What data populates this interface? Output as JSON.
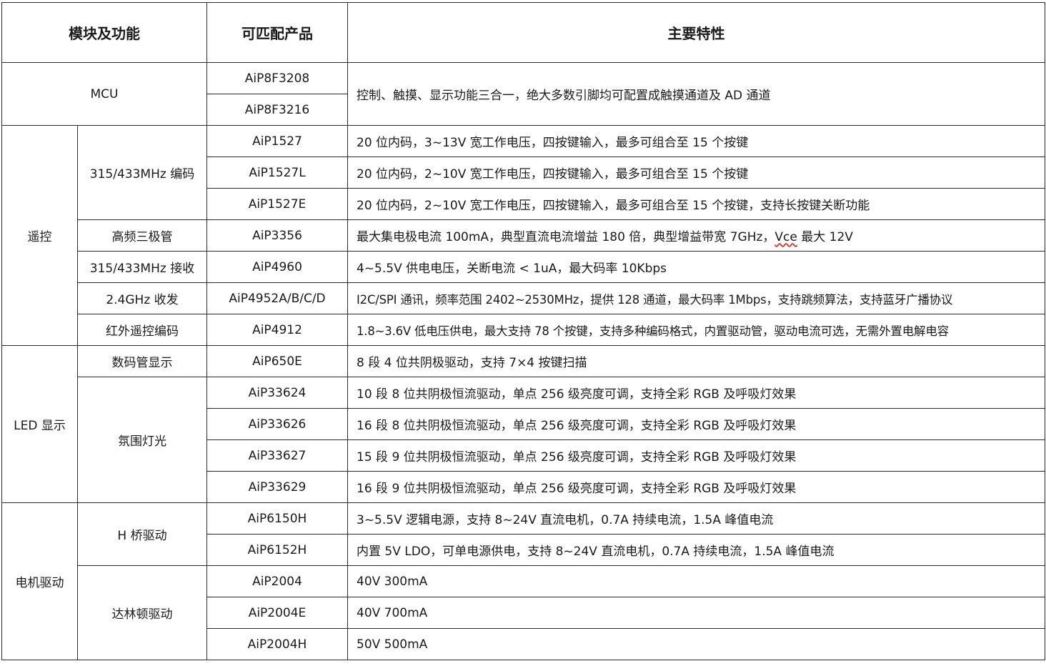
{
  "header": {
    "module": "模块及功能",
    "product": "可匹配产品",
    "feature": "主要特性"
  },
  "mcu": {
    "label": "MCU",
    "products": [
      "AiP8F3208",
      "AiP8F3216"
    ],
    "feature": "控制、触摸、显示功能三合一，绝大多数引脚均可配置成触摸通道及 AD 通道"
  },
  "remote": {
    "label": "遥控",
    "sub_encode": "315/433MHz 编码",
    "sub_triode": "高频三极管",
    "sub_receive": "315/433MHz 接收",
    "sub_24g": "2.4GHz 收发",
    "sub_ir": "红外遥控编码",
    "rows": [
      {
        "product": "AiP1527",
        "feature": "20 位内码，3~13V 宽工作电压，四按键输入，最多可组合至 15 个按键"
      },
      {
        "product": "AiP1527L",
        "feature": "20 位内码，2~10V 宽工作电压，四按键输入，最多可组合至 15 个按键"
      },
      {
        "product": "AiP1527E",
        "feature": "20 位内码，2~10V 宽工作电压，四按键输入，最多可组合至 15 个按键，支持长按键关断功能"
      },
      {
        "product": "AiP3356",
        "feature_pre": "最大集电极电流 100mA，典型直流电流增益 180 倍，典型增益带宽 7GHz，",
        "feature_vce": "Vce",
        "feature_post": " 最大 12V"
      },
      {
        "product": "AiP4960",
        "feature": "4~5.5V 供电电压，关断电流 < 1uA，最大码率 10Kbps"
      },
      {
        "product": "AiP4952A/B/C/D",
        "feature": "I2C/SPI 通讯，频率范围 2402~2530MHz，提供 128 通道，最大码率 1Mbps，支持跳频算法，支持蓝牙广播协议"
      },
      {
        "product": "AiP4912",
        "feature": "1.8~3.6V 低电压供电，最大支持 78 个按键，支持多种编码格式，内置驱动管，驱动电流可选，无需外置电解电容"
      }
    ]
  },
  "led": {
    "label": "LED 显示",
    "sub_digit": "数码管显示",
    "sub_ambient": "氛围灯光",
    "rows": [
      {
        "product": "AiP650E",
        "feature": "8 段 4 位共阴极驱动，支持 7×4 按键扫描"
      },
      {
        "product": "AiP33624",
        "feature": "10 段 8 位共阴极恒流驱动，单点 256 级亮度可调，支持全彩 RGB 及呼吸灯效果"
      },
      {
        "product": "AiP33626",
        "feature": "16 段 8 位共阴极恒流驱动，单点 256 级亮度可调，支持全彩 RGB 及呼吸灯效果"
      },
      {
        "product": "AiP33627",
        "feature": "15 段 9 位共阴极恒流驱动，单点 256 级亮度可调，支持全彩 RGB 及呼吸灯效果"
      },
      {
        "product": "AiP33629",
        "feature": "16 段 9 位共阴极恒流驱动，单点 256 级亮度可调，支持全彩 RGB 及呼吸灯效果"
      }
    ]
  },
  "motor": {
    "label": "电机驱动",
    "sub_hbridge": "H 桥驱动",
    "sub_darlington": "达林顿驱动",
    "rows": [
      {
        "product": "AiP6150H",
        "feature": "3~5.5V 逻辑电源，支持 8~24V 直流电机，0.7A 持续电流，1.5A 峰值电流"
      },
      {
        "product": "AiP6152H",
        "feature": "内置 5V LDO，可单电源供电，支持 8~24V 直流电机，0.7A 持续电流，1.5A 峰值电流"
      },
      {
        "product": "AiP2004",
        "feature": "40V 300mA"
      },
      {
        "product": "AiP2004E",
        "feature": "40V 700mA"
      },
      {
        "product": "AiP2004H",
        "feature": "50V 500mA"
      }
    ]
  }
}
